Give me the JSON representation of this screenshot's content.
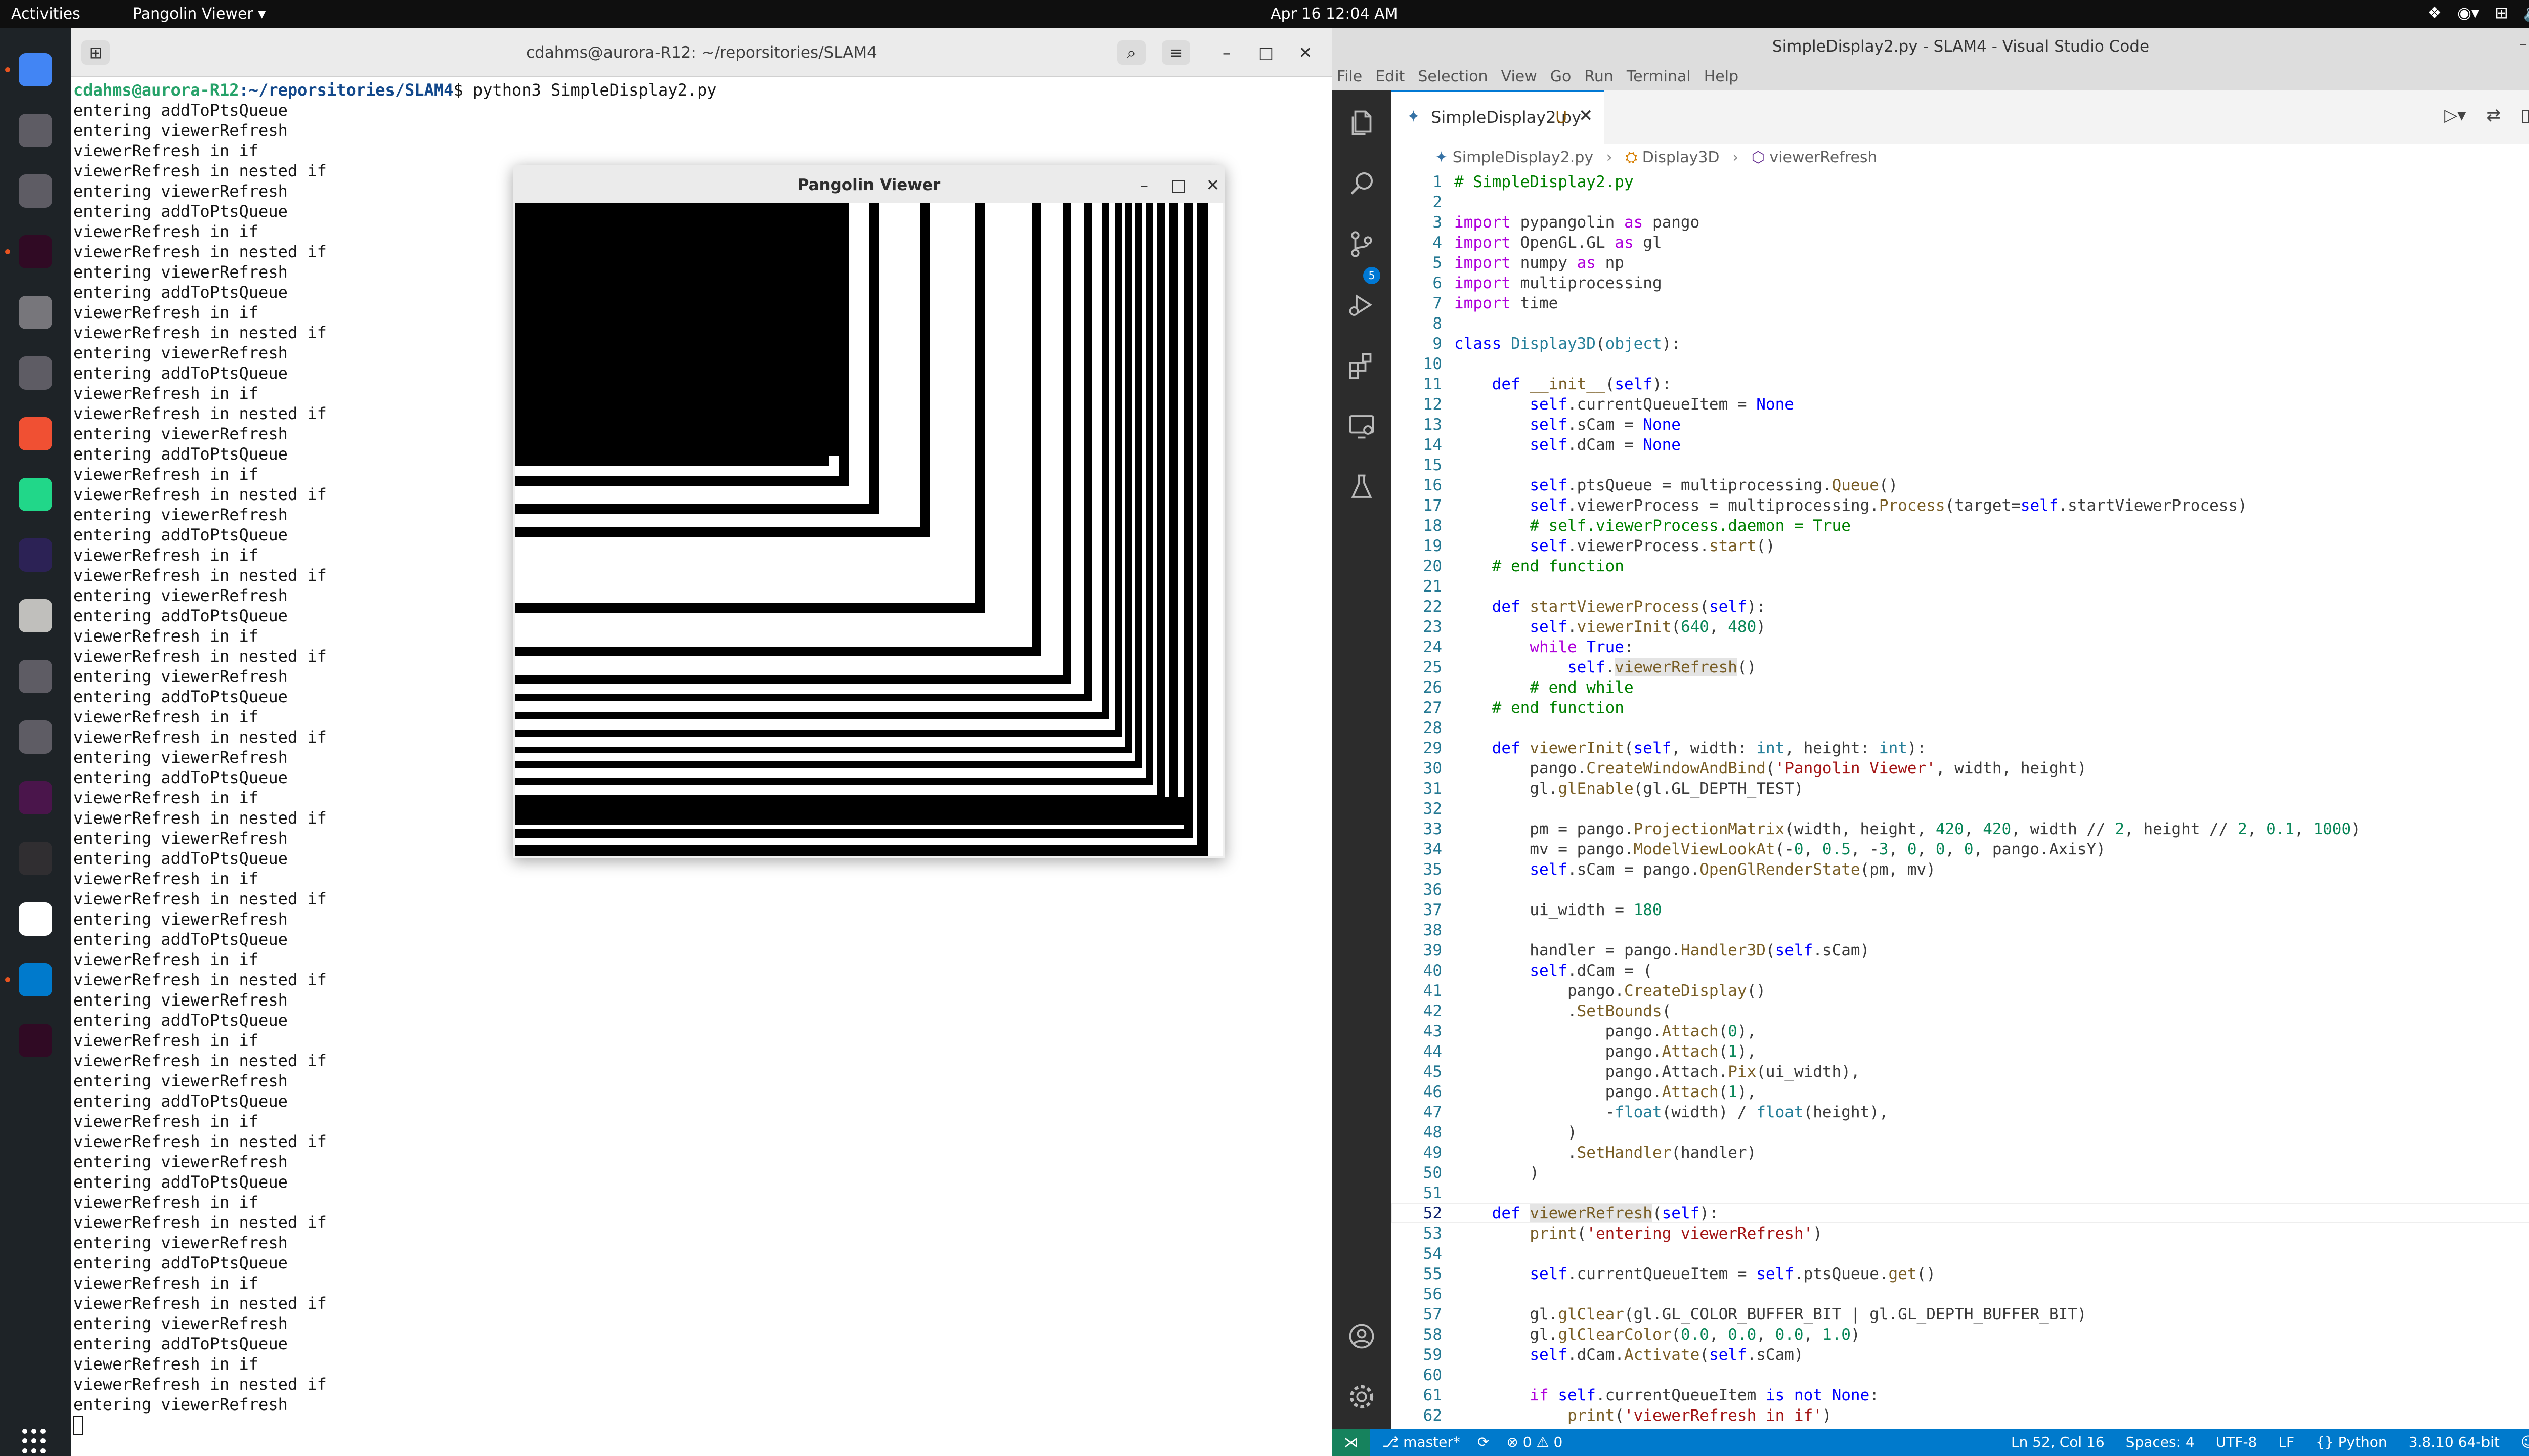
{
  "topbar": {
    "activities": "Activities",
    "app_menu": "Pangolin Viewer ▾",
    "clock": "Apr 16  12:04 AM"
  },
  "dock": {
    "apps": [
      {
        "name": "chrome",
        "color": "#4285f4"
      },
      {
        "name": "files",
        "color": "#5e5c64"
      },
      {
        "name": "text-editor",
        "color": "#5e5c64"
      },
      {
        "name": "terminal",
        "color": "#300a24"
      },
      {
        "name": "settings",
        "color": "#77767b"
      },
      {
        "name": "remote-desktop",
        "color": "#5e5c64"
      },
      {
        "name": "git",
        "color": "#f05033"
      },
      {
        "name": "pycharm",
        "color": "#21d789"
      },
      {
        "name": "eclipse",
        "color": "#2c2255"
      },
      {
        "name": "disk-usage",
        "color": "#c0bfbc"
      },
      {
        "name": "system-monitor",
        "color": "#5e5c64"
      },
      {
        "name": "document-viewer",
        "color": "#5e5c64"
      },
      {
        "name": "slack",
        "color": "#4a154b"
      },
      {
        "name": "obs-studio",
        "color": "#302e31"
      },
      {
        "name": "timer",
        "color": "#ffffff"
      },
      {
        "name": "vscode",
        "color": "#007acc"
      },
      {
        "name": "terminal-2",
        "color": "#300a24"
      }
    ]
  },
  "terminal": {
    "title": "cdahms@aurora-R12: ~/reporsitories/SLAM4",
    "prompt_user": "cdahms@aurora-R12",
    "prompt_path": ":~/reporsitories/SLAM4",
    "prompt_cmd": "$ python3 SimpleDisplay2.py",
    "output": [
      "entering addToPtsQueue",
      "entering viewerRefresh",
      "viewerRefresh in if",
      "viewerRefresh in nested if",
      "entering viewerRefresh",
      "entering addToPtsQueue",
      "viewerRefresh in if",
      "viewerRefresh in nested if",
      "entering viewerRefresh",
      "entering addToPtsQueue",
      "viewerRefresh in if",
      "viewerRefresh in nested if",
      "entering viewerRefresh",
      "entering addToPtsQueue",
      "viewerRefresh in if",
      "viewerRefresh in nested if",
      "entering viewerRefresh",
      "entering addToPtsQueue",
      "viewerRefresh in if",
      "viewerRefresh in nested if",
      "entering viewerRefresh",
      "entering addToPtsQueue",
      "viewerRefresh in if",
      "viewerRefresh in nested if",
      "entering viewerRefresh",
      "entering addToPtsQueue",
      "viewerRefresh in if",
      "viewerRefresh in nested if",
      "entering viewerRefresh",
      "entering addToPtsQueue",
      "viewerRefresh in if",
      "viewerRefresh in nested if",
      "entering viewerRefresh",
      "entering addToPtsQueue",
      "viewerRefresh in if",
      "viewerRefresh in nested if",
      "entering viewerRefresh",
      "entering addToPtsQueue",
      "viewerRefresh in if",
      "viewerRefresh in nested if",
      "entering viewerRefresh",
      "entering addToPtsQueue",
      "viewerRefresh in if",
      "viewerRefresh in nested if",
      "entering viewerRefresh",
      "entering addToPtsQueue",
      "viewerRefresh in if",
      "viewerRefresh in nested if",
      "entering viewerRefresh",
      "entering addToPtsQueue",
      "viewerRefresh in if",
      "viewerRefresh in nested if",
      "entering viewerRefresh",
      "entering addToPtsQueue",
      "viewerRefresh in if",
      "viewerRefresh in nested if",
      "entering viewerRefresh",
      "entering addToPtsQueue",
      "viewerRefresh in if",
      "viewerRefresh in nested if",
      "entering viewerRefresh",
      "entering addToPtsQueue",
      "viewerRefresh in if",
      "viewerRefresh in nested if",
      "entering viewerRefresh"
    ]
  },
  "pangolin": {
    "title": "Pangolin Viewer"
  },
  "vscode": {
    "title": "SimpleDisplay2.py - SLAM4 - Visual Studio Code",
    "menu": [
      "File",
      "Edit",
      "Selection",
      "View",
      "Go",
      "Run",
      "Terminal",
      "Help"
    ],
    "tab_label": "SimpleDisplay2.py",
    "tab_status": "U",
    "scm_badge": "5",
    "breadcrumb": [
      "SimpleDisplay2.py",
      "Display3D",
      "viewerRefresh"
    ],
    "code": [
      "<span class=\"cm\"># SimpleDisplay2.py</span>",
      "",
      "<span class=\"kw2\">import</span> pypangolin <span class=\"kw2\">as</span> pango",
      "<span class=\"kw2\">import</span> OpenGL.GL <span class=\"kw2\">as</span> gl",
      "<span class=\"kw2\">import</span> numpy <span class=\"kw2\">as</span> np",
      "<span class=\"kw2\">import</span> multiprocessing",
      "<span class=\"kw2\">import</span> time",
      "",
      "<span class=\"kw\">class</span> <span class=\"cls\">Display3D</span>(<span class=\"cls\">object</span>):",
      "",
      "    <span class=\"kw\">def</span> <span class=\"fn\">__init__</span>(<span class=\"kw\">self</span>):",
      "        <span class=\"kw\">self</span>.currentQueueItem = <span class=\"kw\">None</span>",
      "        <span class=\"kw\">self</span>.sCam = <span class=\"kw\">None</span>",
      "        <span class=\"kw\">self</span>.dCam = <span class=\"kw\">None</span>",
      "",
      "        <span class=\"kw\">self</span>.ptsQueue = multiprocessing.<span class=\"fn\">Queue</span>()",
      "        <span class=\"kw\">self</span>.viewerProcess = multiprocessing.<span class=\"fn\">Process</span>(target=<span class=\"kw\">self</span>.startViewerProcess)",
      "        <span class=\"cm\"># self.viewerProcess.daemon = True</span>",
      "        <span class=\"kw\">self</span>.viewerProcess.<span class=\"fn\">start</span>()",
      "    <span class=\"cm\"># end function</span>",
      "",
      "    <span class=\"kw\">def</span> <span class=\"fn\">startViewerProcess</span>(<span class=\"kw\">self</span>):",
      "        <span class=\"kw\">self</span>.<span class=\"fn\">viewerInit</span>(<span class=\"num\">640</span>, <span class=\"num\">480</span>)",
      "        <span class=\"kw2\">while</span> <span class=\"kw\">True</span>:",
      "            <span class=\"kw\">self</span>.<span class=\"fn hl\">viewerRefresh</span>()",
      "        <span class=\"cm\"># end while</span>",
      "    <span class=\"cm\"># end function</span>",
      "",
      "    <span class=\"kw\">def</span> <span class=\"fn\">viewerInit</span>(<span class=\"kw\">self</span>, width: <span class=\"builtin\">int</span>, height: <span class=\"builtin\">int</span>):",
      "        pango.<span class=\"fn\">CreateWindowAndBind</span>(<span class=\"str\">'Pangolin Viewer'</span>, width, height)",
      "        gl.<span class=\"fn\">glEnable</span>(gl.GL_DEPTH_TEST)",
      "",
      "        pm = pango.<span class=\"fn\">ProjectionMatrix</span>(width, height, <span class=\"num\">420</span>, <span class=\"num\">420</span>, width // <span class=\"num\">2</span>, height // <span class=\"num\">2</span>, <span class=\"num\">0.1</span>, <span class=\"num\">1000</span>)",
      "        mv = pango.<span class=\"fn\">ModelViewLookAt</span>(-<span class=\"num\">0</span>, <span class=\"num\">0.5</span>, -<span class=\"num\">3</span>, <span class=\"num\">0</span>, <span class=\"num\">0</span>, <span class=\"num\">0</span>, pango.AxisY)",
      "        <span class=\"kw\">self</span>.sCam = pango.<span class=\"fn\">OpenGlRenderState</span>(pm, mv)",
      "",
      "        ui_width = <span class=\"num\">180</span>",
      "",
      "        handler = pango.<span class=\"fn\">Handler3D</span>(<span class=\"kw\">self</span>.sCam)",
      "        <span class=\"kw\">self</span>.dCam = (",
      "            pango.<span class=\"fn\">CreateDisplay</span>()",
      "            .<span class=\"fn\">SetBounds</span>(",
      "                pango.<span class=\"fn\">Attach</span>(<span class=\"num\">0</span>),",
      "                pango.<span class=\"fn\">Attach</span>(<span class=\"num\">1</span>),",
      "                pango.Attach.<span class=\"fn\">Pix</span>(ui_width),",
      "                pango.<span class=\"fn\">Attach</span>(<span class=\"num\">1</span>),",
      "                -<span class=\"builtin\">float</span>(width) / <span class=\"builtin\">float</span>(height),",
      "            )",
      "            .<span class=\"fn\">SetHandler</span>(handler)",
      "        )",
      "",
      "    <span class=\"kw\">def</span> <span class=\"fn hl\">viewerRefresh</span>(<span class=\"kw\">self</span>):",
      "        <span class=\"fn\">print</span>(<span class=\"str\">'entering viewerRefresh'</span>)",
      "",
      "        <span class=\"kw\">self</span>.currentQueueItem = <span class=\"kw\">self</span>.ptsQueue.<span class=\"fn\">get</span>()",
      "",
      "        gl.<span class=\"fn\">glClear</span>(gl.GL_COLOR_BUFFER_BIT | gl.GL_DEPTH_BUFFER_BIT)",
      "        gl.<span class=\"fn\">glClearColor</span>(<span class=\"num\">0.0</span>, <span class=\"num\">0.0</span>, <span class=\"num\">0.0</span>, <span class=\"num\">1.0</span>)",
      "        <span class=\"kw\">self</span>.dCam.<span class=\"fn\">Activate</span>(<span class=\"kw\">self</span>.sCam)",
      "",
      "        <span class=\"kw2\">if</span> <span class=\"kw\">self</span>.currentQueueItem <span class=\"kw\">is not</span> <span class=\"kw\">None</span>:",
      "            <span class=\"fn\">print</span>(<span class=\"str\">'viewerRefresh in if'</span>)"
    ],
    "active_line": 52,
    "status": {
      "branch": "master*",
      "problems": "⊗ 0 ⚠ 0",
      "position": "Ln 52, Col 16",
      "spaces": "Spaces: 4",
      "encoding": "UTF-8",
      "eol": "LF",
      "language": "Python",
      "interpreter": "3.8.10 64-bit"
    }
  }
}
